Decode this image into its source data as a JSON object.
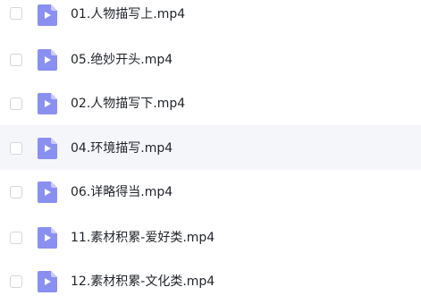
{
  "files": [
    {
      "name": "01.人物描写上.mp4"
    },
    {
      "name": "05.绝妙开头.mp4"
    },
    {
      "name": "02.人物描写下.mp4"
    },
    {
      "name": "04.环境描写.mp4"
    },
    {
      "name": "06.详略得当.mp4"
    },
    {
      "name": "11.素材积累-爱好类.mp4"
    },
    {
      "name": "12.素材积累-文化类.mp4"
    }
  ],
  "icon": "video-file-icon",
  "colors": {
    "icon_fill": "#8a8ff2",
    "icon_fold": "#c9cbfa",
    "hover_row": "#f5f6fa"
  }
}
